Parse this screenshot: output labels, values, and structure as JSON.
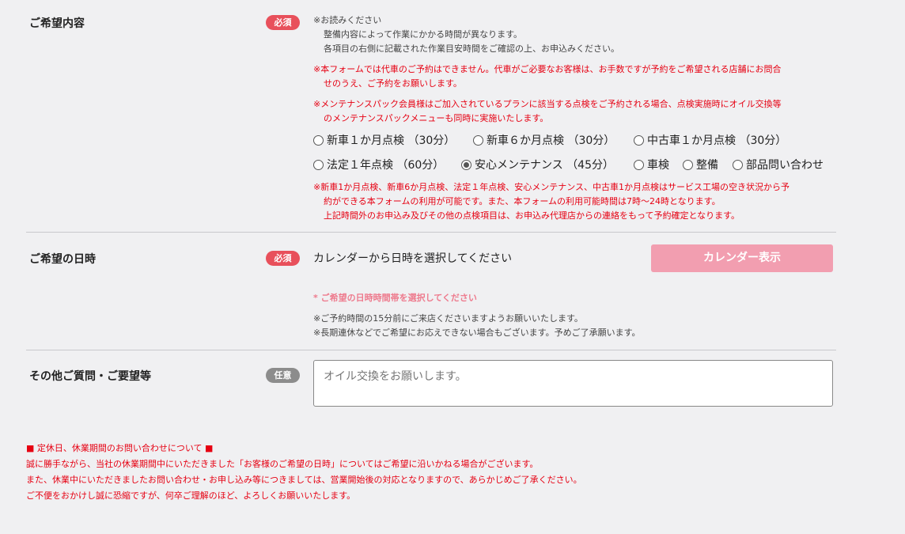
{
  "desired_content": {
    "label": "ご希望内容",
    "badge": "必須",
    "note_lines": [
      "※お読みください",
      "整備内容によって作業にかかる時間が異なります。",
      "各項目の右側に記載された作業目安時間をご確認の上、お申込みください。"
    ],
    "warning1": [
      "※本フォームでは代車のご予約はできません。代車がご必要なお客様は、お手数ですが予約をご希望される店舗にお問合",
      "せのうえ、ご予約をお願いします。"
    ],
    "warning2": [
      "※メンテナンスパック会員様はご加入されているプランに該当する点検をご予約される場合、点検実施時にオイル交換等",
      "のメンテナンスパックメニューも同時に実施いたします。"
    ],
    "options": [
      {
        "label": "新車１か月点検 （30分）",
        "selected": false
      },
      {
        "label": "新車６か月点検 （30分）",
        "selected": false
      },
      {
        "label": "中古車１か月点検 （30分）",
        "selected": false
      },
      {
        "label": "法定１年点検 （60分）",
        "selected": false
      },
      {
        "label": "安心メンテナンス （45分）",
        "selected": true
      },
      {
        "label": "車検",
        "selected": false
      },
      {
        "label": "整備",
        "selected": false
      },
      {
        "label": "部品問い合わせ",
        "selected": false
      }
    ],
    "warning3": [
      "※新車1か月点検、新車6か月点検、法定１年点検、安心メンテナンス、中古車1か月点検はサービス工場の空き状況から予",
      "約ができる本フォームの利用が可能です。また、本フォームの利用可能時間は7時～24時となります。",
      "上記時間外のお申込み及びその他の点検項目は、お申込み代理店からの連絡をもって予約確定となります。"
    ]
  },
  "desired_datetime": {
    "label": "ご希望の日時",
    "badge": "必須",
    "instruction": "カレンダーから日時を選択してください",
    "button": "カレンダー表示",
    "pink_note": "* ご希望の日時時間帯を選択してください",
    "notes": [
      "※ご予約時間の15分前にご来店くださいますようお願いいたします。",
      "※長期連休などでご希望にお応えできない場合もございます。予めご了承願います。"
    ]
  },
  "other_questions": {
    "label": "その他ご質問・ご要望等",
    "badge": "任意",
    "placeholder": "オイル交換をお願いします。"
  },
  "holiday_notice": {
    "title": "■ 定休日、休業期間のお問い合わせについて ■",
    "lines": [
      "誠に勝手ながら、当社の休業期間中にいただきました「お客様のご希望の日時」についてはご希望に沿いかねる場合がございます。",
      "また、休業中にいただきましたお問い合わせ・お申し込み等につきましては、営業開始後の対応となりますので、あらかじめご了承ください。",
      "ご不便をおかけし誠に恐縮ですが、何卒ご理解のほど、よろしくお願いいたします。"
    ]
  },
  "colors": {
    "required_badge": "#e8505b",
    "optional_badge": "#8c8c8c",
    "warning_text": "#e60012",
    "calendar_button": "#f29eb0",
    "pink_note": "#ee7a8d"
  }
}
